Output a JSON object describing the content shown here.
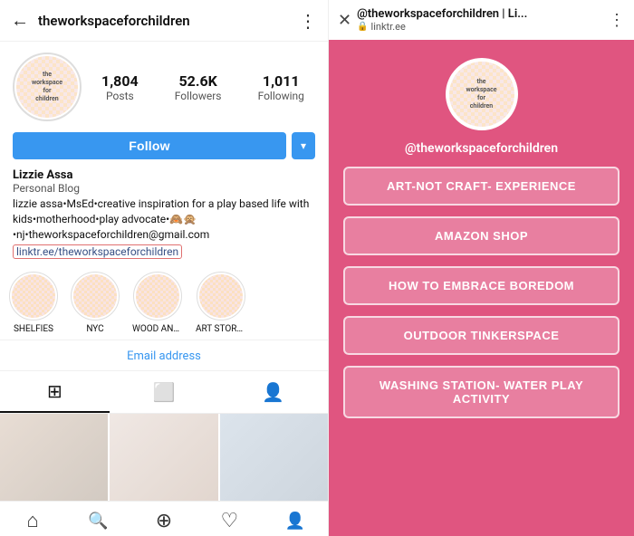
{
  "left": {
    "top_bar": {
      "back_icon": "←",
      "title": "theworkspaceforchildren",
      "menu_icon": "⋮"
    },
    "profile": {
      "avatar_line1": "the",
      "avatar_line2": "workspace",
      "avatar_line3": "for",
      "avatar_line4": "children",
      "stats": [
        {
          "number": "1,804",
          "label": "Posts"
        },
        {
          "number": "52.6K",
          "label": "Followers"
        },
        {
          "number": "1,011",
          "label": "Following"
        }
      ]
    },
    "follow_button": "Follow",
    "dropdown_icon": "▾",
    "bio": {
      "name": "Lizzie Assa",
      "type": "Personal Blog",
      "text": "lizzie assa•MsEd•creative inspiration for a play based life with kids•motherhood•play advocate•🙈🙊•nj•theworkspaceforchildren@gmail.com",
      "link_text": "linktr.ee/theworkspaceforchildren"
    },
    "highlights": [
      {
        "label": "SHELFIES"
      },
      {
        "label": "NYC"
      },
      {
        "label": "WOOD AND ..."
      },
      {
        "label": "ART STORAGE ON B"
      }
    ],
    "email_address": "Email address",
    "tabs": [
      {
        "icon": "⊞",
        "active": true
      },
      {
        "icon": "⬜",
        "active": false
      },
      {
        "icon": "👤",
        "active": false
      }
    ],
    "bottom_nav": [
      {
        "icon": "⌂",
        "name": "home"
      },
      {
        "icon": "🔍",
        "name": "search"
      },
      {
        "icon": "⊕",
        "name": "add"
      },
      {
        "icon": "♡",
        "name": "likes"
      },
      {
        "icon": "●",
        "name": "profile"
      }
    ]
  },
  "right": {
    "top_bar": {
      "close_icon": "✕",
      "title": "@theworkspaceforchildren | Li...",
      "subtitle": "linktr.ee",
      "lock_icon": "🔒",
      "menu_icon": "⋮"
    },
    "avatar_line1": "the",
    "avatar_line2": "workspace",
    "avatar_line3": "for",
    "avatar_line4": "children",
    "handle": "@theworkspaceforchildren",
    "buttons": [
      "ART-NOT CRAFT- EXPERIENCE",
      "AMAZON SHOP",
      "HOW TO EMBRACE BOREDOM",
      "OUTDOOR TINKERSPACE",
      "WASHING STATION- WATER PLAY ACTIVITY"
    ]
  }
}
